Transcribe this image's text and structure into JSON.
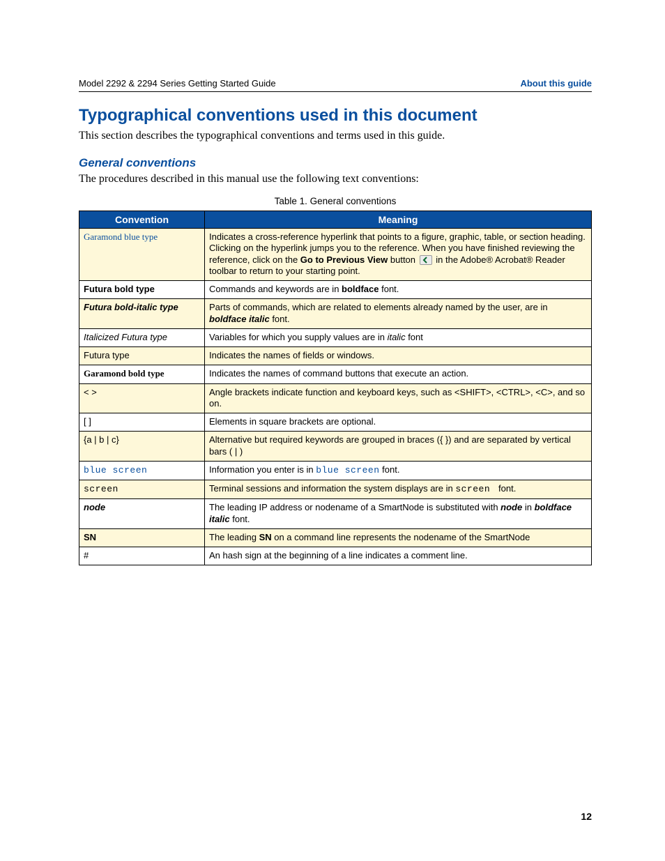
{
  "header": {
    "left": "Model 2292 & 2294 Series Getting Started Guide",
    "right": "About this guide"
  },
  "section": {
    "title": "Typographical conventions used in this document",
    "intro": "This section describes the typographical conventions and terms used in this guide."
  },
  "sub": {
    "title": "General conventions",
    "intro": "The procedures described in this manual use the following text conventions:"
  },
  "table": {
    "caption": "Table 1. General conventions",
    "headers": {
      "col1": "Convention",
      "col2": "Meaning"
    },
    "rows": [
      {
        "conv_html": "<span class='garamond blue'>Garamond blue type</span>",
        "meaning_html": "Indicates a cross-reference hyperlink that points to a figure, graphic, table, or section heading. Clicking on the hyperlink jumps you to the reference. When you have finished reviewing the reference, click on the <span class='bold'>Go to Previous View</span> button <span class='icon-prev' data-name='go-to-previous-view-icon' data-interactable='false'><svg viewBox='0 0 10 10'><path d='M6 1 L2 5 L6 9' fill='none' stroke='#0a6b2f' stroke-width='2'/></svg></span> in the Adobe® Acrobat® Reader toolbar to return to your starting point.",
        "shaded": true
      },
      {
        "conv_html": "<span class='bold'>Futura bold type</span>",
        "meaning_html": "Commands and keywords are in <span class='bold'>boldface</span> font.",
        "shaded": false
      },
      {
        "conv_html": "<span class='bold italic'>Futura bold-italic type</span>",
        "meaning_html": "Parts of commands, which are related to elements already named by the user, are in <span class='bold italic'>boldface italic</span> font.",
        "shaded": true
      },
      {
        "conv_html": "<span class='italic'>Italicized Futura type</span>",
        "meaning_html": "Variables for which you supply values are in <span class='italic'>italic</span> font",
        "shaded": false
      },
      {
        "conv_html": "Futura type",
        "meaning_html": "Indicates the names of fields or windows.",
        "shaded": true
      },
      {
        "conv_html": "<span class='garamond bold'>Garamond bold type</span>",
        "meaning_html": "Indicates the names of command buttons that execute an action.",
        "shaded": false
      },
      {
        "conv_html": "&lt; &gt;",
        "meaning_html": "Angle brackets indicate function and keyboard keys, such as &lt;SHIFT&gt;, &lt;CTRL&gt;, &lt;C&gt;, and so on.",
        "shaded": true
      },
      {
        "conv_html": "[ ]",
        "meaning_html": "Elements in square brackets are optional.",
        "shaded": false
      },
      {
        "conv_html": "{a | b | c}",
        "meaning_html": "Alternative but required keywords are grouped in braces ({ }) and are separated by vertical bars ( | )",
        "shaded": true
      },
      {
        "conv_html": "<span class='mono blue'>blue screen</span>",
        "meaning_html": "Information you enter is in <span class='mono blue'>blue screen</span> font.",
        "shaded": false
      },
      {
        "conv_html": "<span class='mono'>screen</span>",
        "meaning_html": "Terminal sessions and information the system displays are in <span class='mono'>screen&nbsp;</span> font.",
        "shaded": true
      },
      {
        "conv_html": "<span class='bold italic'>node</span>",
        "meaning_html": "The leading IP address or nodename of a SmartNode is substituted with <span class='bold italic'>node</span> in <span class='bold italic'>boldface italic</span> font.",
        "shaded": false
      },
      {
        "conv_html": "<span class='bold'>SN</span>",
        "meaning_html": "The leading <span class='bold'>SN</span> on a command line represents the nodename of the SmartNode",
        "shaded": true
      },
      {
        "conv_html": "#",
        "meaning_html": "An hash sign at the beginning of a line indicates a comment line.",
        "shaded": false
      }
    ]
  },
  "page_number": "12"
}
